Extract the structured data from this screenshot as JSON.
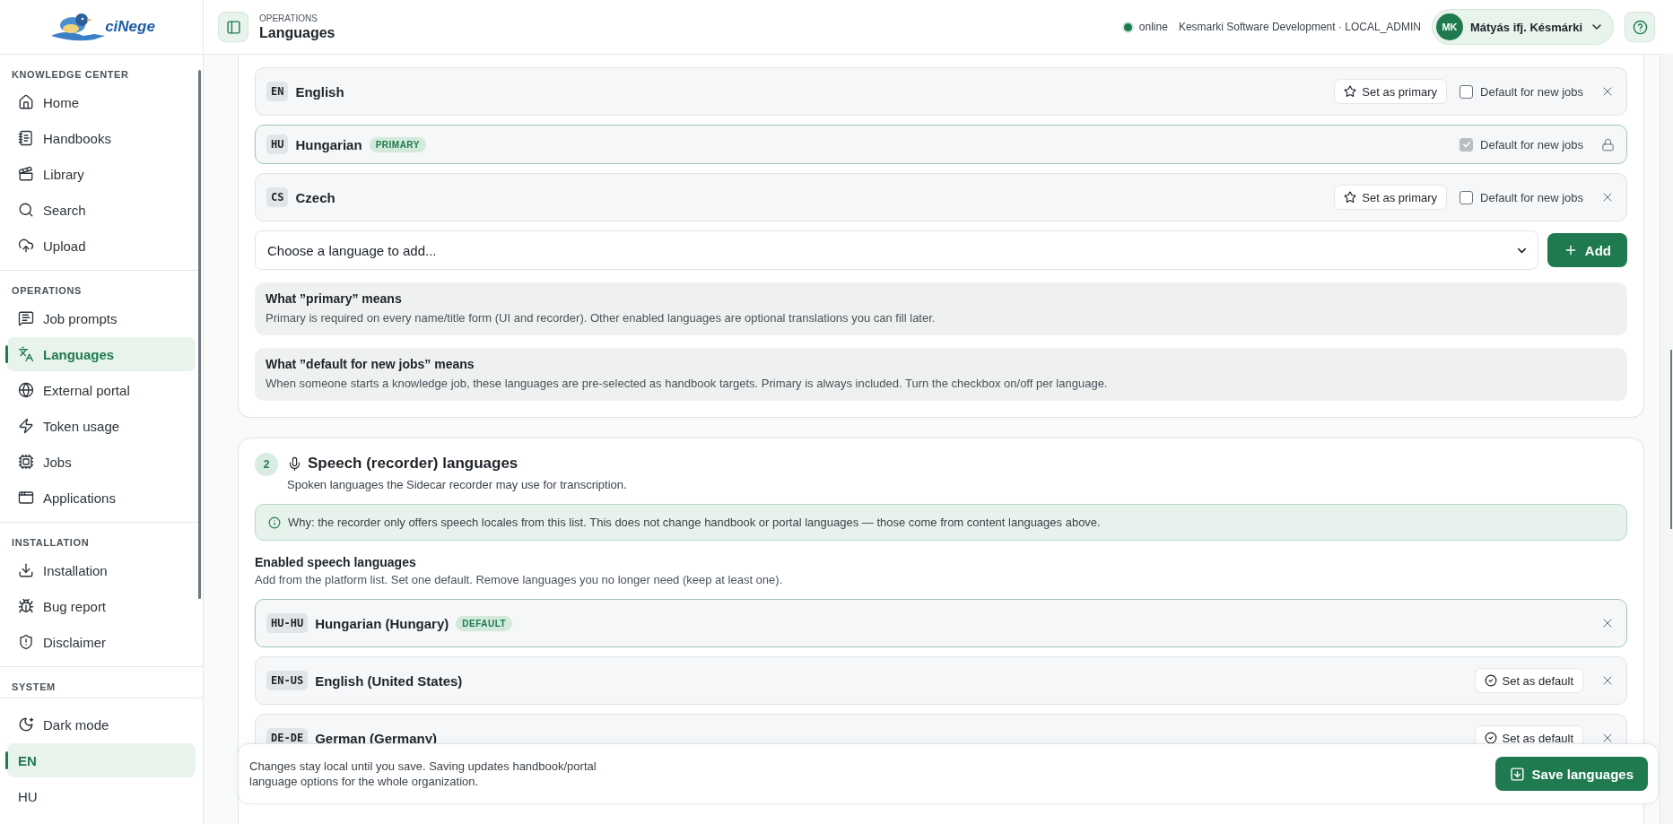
{
  "sidebar": {
    "logo_text": "ciNege",
    "sections": [
      {
        "heading": "KNOWLEDGE CENTER",
        "items": [
          {
            "label": "Home",
            "selected": false
          },
          {
            "label": "Handbooks",
            "selected": false
          },
          {
            "label": "Library",
            "selected": false
          },
          {
            "label": "Search",
            "selected": false
          },
          {
            "label": "Upload",
            "selected": false
          }
        ]
      },
      {
        "heading": "OPERATIONS",
        "items": [
          {
            "label": "Job prompts",
            "selected": false
          },
          {
            "label": "Languages",
            "selected": true
          },
          {
            "label": "External portal",
            "selected": false
          },
          {
            "label": "Token usage",
            "selected": false
          },
          {
            "label": "Jobs",
            "selected": false
          },
          {
            "label": "Applications",
            "selected": false
          }
        ]
      },
      {
        "heading": "INSTALLATION",
        "items": [
          {
            "label": "Installation",
            "selected": false
          },
          {
            "label": "Bug report",
            "selected": false
          },
          {
            "label": "Disclaimer",
            "selected": false
          }
        ]
      },
      {
        "heading": "SYSTEM"
      }
    ],
    "footer_items": [
      {
        "kind": "toggle",
        "label": "Dark mode",
        "selected": false
      },
      {
        "kind": "locale",
        "label": "EN",
        "selected": true
      },
      {
        "kind": "locale",
        "label": "HU",
        "selected": false
      }
    ]
  },
  "header": {
    "section": "OPERATIONS",
    "title": "Languages",
    "status": "online",
    "org": "Kesmarki Software Development · LOCAL_ADMIN",
    "user": {
      "initials": "MK",
      "name": "Mátyás ifj. Késmárki"
    }
  },
  "content_languages": {
    "rows": [
      {
        "code": "EN",
        "name": "English",
        "primary": false,
        "action": "Set as primary",
        "default_label": "Default for new jobs",
        "default_for_new_jobs": false
      },
      {
        "code": "HU",
        "name": "Hungarian",
        "primary": true,
        "badge": "PRIMARY",
        "default_label": "Default for new jobs",
        "default_for_new_jobs": true
      },
      {
        "code": "CS",
        "name": "Czech",
        "primary": false,
        "action": "Set as primary",
        "default_label": "Default for new jobs",
        "default_for_new_jobs": false
      }
    ],
    "select": {
      "placeholder": "Choose a language to add..."
    },
    "add_button": "Add",
    "notes": [
      {
        "title": "What ”primary” means",
        "text": "Primary is required on every name/title form (UI and recorder). Other enabled languages are optional translations you can fill later."
      },
      {
        "title": "What ”default for new jobs” means",
        "text": "When someone starts a knowledge job, these languages are pre-selected as handbook targets. Primary is always included. Turn the checkbox on/off per language."
      }
    ]
  },
  "speech": {
    "step": "2",
    "title": "Speech (recorder) languages",
    "subtitle": "Spoken languages the Sidecar recorder may use for transcription.",
    "why": "Why: the recorder only offers speech locales from this list. This does not change handbook or portal languages — those come from content languages above.",
    "list_title": "Enabled speech languages",
    "list_hint": "Add from the platform list. Set one default. Remove languages you no longer need (keep at least one).",
    "rows": [
      {
        "code": "HU-HU",
        "name": "Hungarian (Hungary)",
        "default": true,
        "badge": "DEFAULT"
      },
      {
        "code": "EN-US",
        "name": "English (United States)",
        "default": false,
        "action": "Set as default"
      },
      {
        "code": "DE-DE",
        "name": "German (Germany)",
        "default": false,
        "action": "Set as default"
      }
    ]
  },
  "save_bar": {
    "text": "Changes stay local until you save. Saving updates handbook/portal language options for the whole organization.",
    "button": "Save languages"
  }
}
